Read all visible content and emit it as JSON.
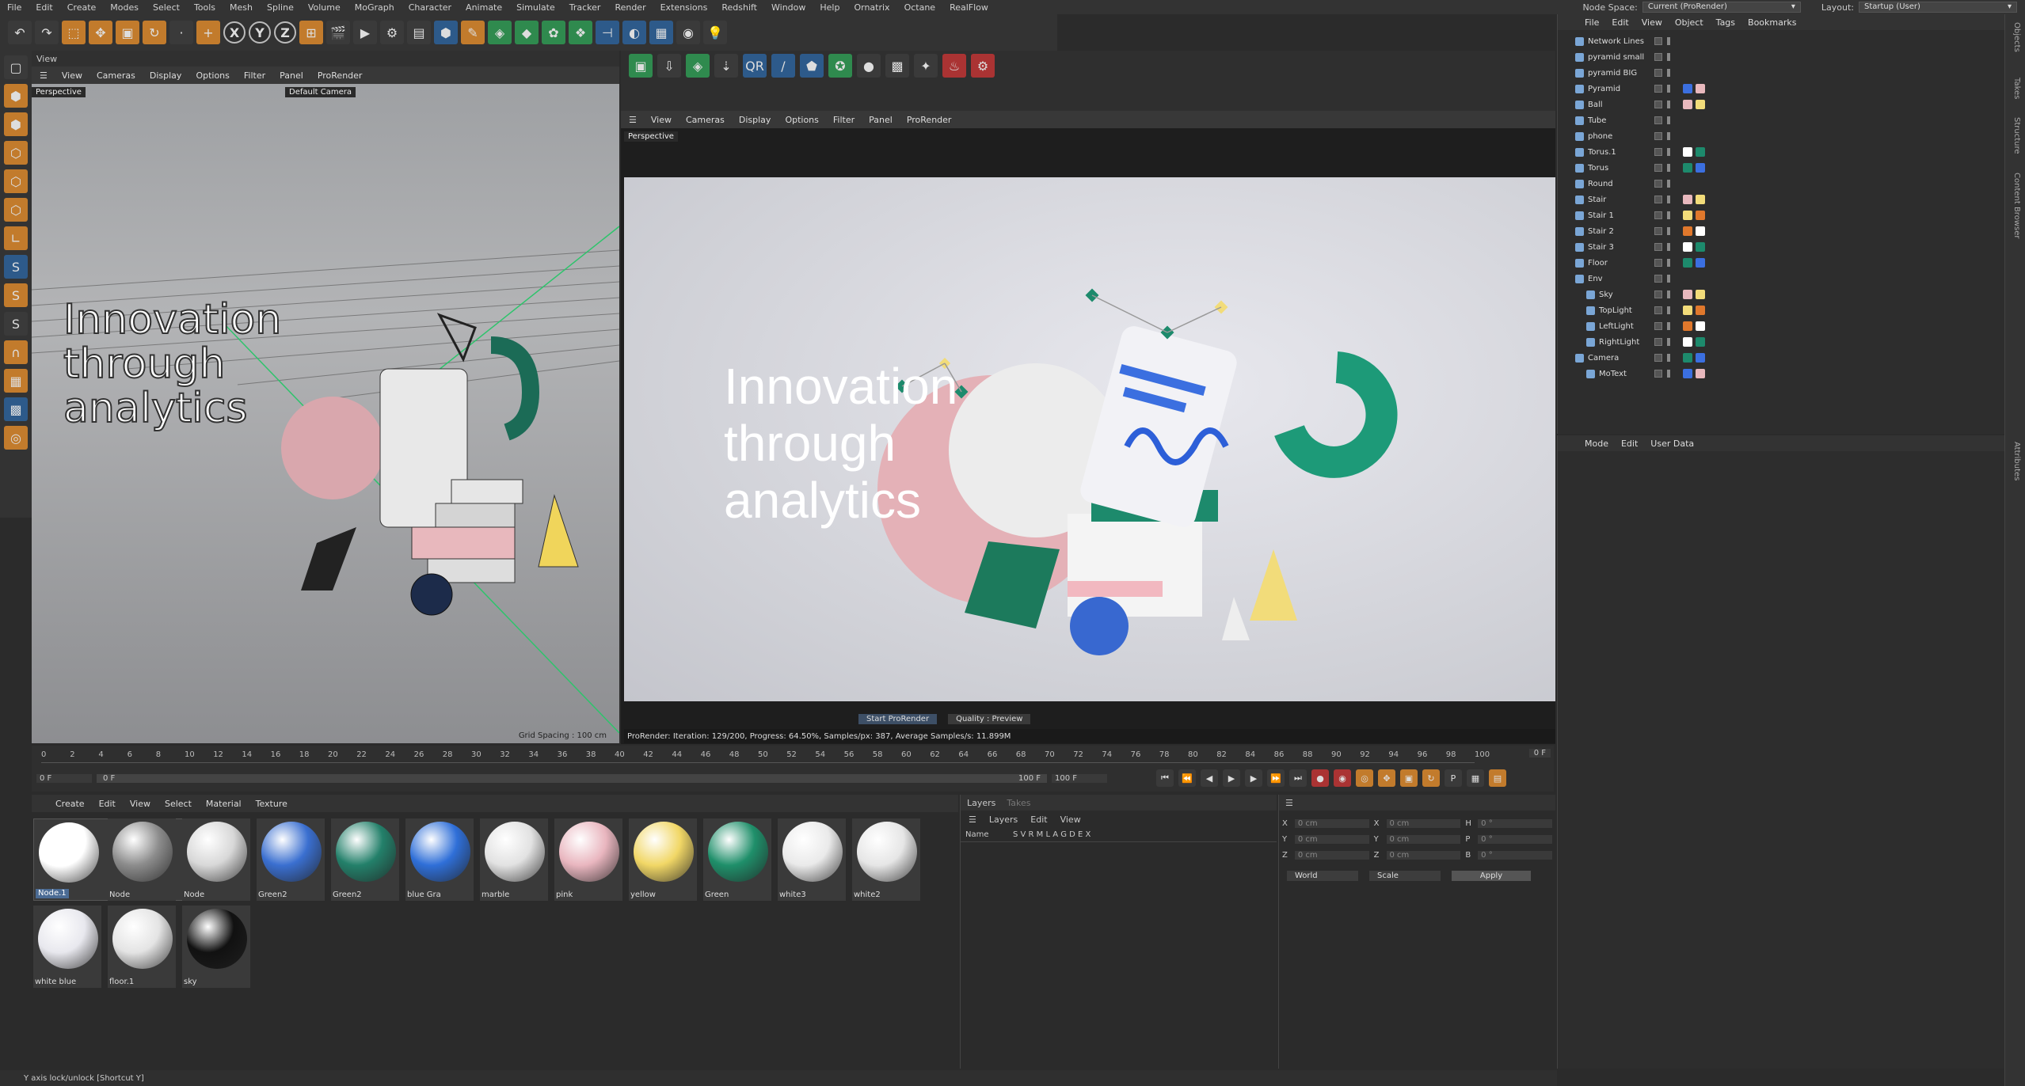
{
  "menubar": {
    "items": [
      "File",
      "Edit",
      "Create",
      "Modes",
      "Select",
      "Tools",
      "Mesh",
      "Spline",
      "Volume",
      "MoGraph",
      "Character",
      "Animate",
      "Simulate",
      "Tracker",
      "Render",
      "Extensions",
      "Redshift",
      "Window",
      "Help",
      "Ornatrix",
      "Octane",
      "RealFlow"
    ],
    "node_space_label": "Node Space:",
    "node_space_value": "Current (ProRender)",
    "layout_label": "Layout:",
    "layout_value": "Startup (User)"
  },
  "viewport_left": {
    "tab": "View",
    "menu": [
      "View",
      "Cameras",
      "Display",
      "Options",
      "Filter",
      "Panel",
      "ProRender"
    ],
    "label": "Perspective",
    "camera": "Default Camera",
    "grid_spacing": "Grid Spacing : 100 cm",
    "text3d": "Innovation\nthrough\nanalytics"
  },
  "viewport_right": {
    "menu": [
      "View",
      "Cameras",
      "Display",
      "Options",
      "Filter",
      "Panel",
      "ProRender"
    ],
    "label": "Perspective",
    "render_text": "Innovation\nthrough\nanalytics",
    "status": "ProRender: Iteration: 129/200, Progress: 64.50%, Samples/px: 387, Average Samples/s: 11.899M",
    "start_button": "Start ProRender",
    "quality_button": "Quality : Preview"
  },
  "timeline": {
    "ticks": [
      "0",
      "2",
      "4",
      "6",
      "8",
      "10",
      "12",
      "14",
      "16",
      "18",
      "20",
      "22",
      "24",
      "26",
      "28",
      "30",
      "32",
      "34",
      "36",
      "38",
      "40",
      "42",
      "44",
      "46",
      "48",
      "50",
      "52",
      "54",
      "56",
      "58",
      "60",
      "62",
      "64",
      "66",
      "68",
      "70",
      "72",
      "74",
      "76",
      "78",
      "80",
      "82",
      "84",
      "86",
      "88",
      "90",
      "92",
      "94",
      "96",
      "98",
      "100"
    ],
    "current_frame": "0 F",
    "start_field": "0 F",
    "start_field2": "0 F",
    "end_field": "100 F",
    "end_field2": "100 F"
  },
  "materials": {
    "menu": [
      "Create",
      "Edit",
      "View",
      "Select",
      "Material",
      "Texture"
    ],
    "items": [
      {
        "name": "Node.1",
        "color": "#ffffff"
      },
      {
        "name": "Node",
        "color": "#8c8c8c"
      },
      {
        "name": "Node",
        "color": "#d8d8d8"
      },
      {
        "name": "Green2",
        "color": "#3a6fd0"
      },
      {
        "name": "Green2",
        "color": "#23806a"
      },
      {
        "name": "blue Gra",
        "color": "#2f6fd8"
      },
      {
        "name": "marble",
        "color": "#e2e2e2"
      },
      {
        "name": "pink",
        "color": "#e9b6bf"
      },
      {
        "name": "yellow",
        "color": "#f1d766"
      },
      {
        "name": "Green",
        "color": "#1f8f6a"
      },
      {
        "name": "white3",
        "color": "#eaeaea"
      },
      {
        "name": "white2",
        "color": "#e6e6e6"
      },
      {
        "name": "white blue",
        "color": "#e8e8ee"
      },
      {
        "name": "floor.1",
        "color": "#e4e4e4"
      },
      {
        "name": "sky",
        "color": "#111111"
      }
    ]
  },
  "layers": {
    "tabs": [
      "Layers",
      "Takes"
    ],
    "menu": [
      "Layers",
      "Edit",
      "View"
    ],
    "col_name": "Name",
    "col_flags": "S V R M L A G D E X"
  },
  "coords": {
    "rows": [
      {
        "a": "X",
        "av": "0 cm",
        "b": "X",
        "bv": "0 cm",
        "c": "H",
        "cv": "0 °"
      },
      {
        "a": "Y",
        "av": "0 cm",
        "b": "Y",
        "bv": "0 cm",
        "c": "P",
        "cv": "0 °"
      },
      {
        "a": "Z",
        "av": "0 cm",
        "b": "Z",
        "bv": "0 cm",
        "c": "B",
        "cv": "0 °"
      }
    ],
    "space": "World",
    "mode": "Scale",
    "apply": "Apply"
  },
  "objects": {
    "menu": [
      "File",
      "Edit",
      "View",
      "Object",
      "Tags",
      "Bookmarks"
    ],
    "items": [
      {
        "name": "Network Lines",
        "indent": 0
      },
      {
        "name": "pyramid small",
        "indent": 0
      },
      {
        "name": "pyramid BIG",
        "indent": 0
      },
      {
        "name": "Pyramid",
        "indent": 0
      },
      {
        "name": "Ball",
        "indent": 0
      },
      {
        "name": "Tube",
        "indent": 0
      },
      {
        "name": "phone",
        "indent": 0
      },
      {
        "name": "Torus.1",
        "indent": 0
      },
      {
        "name": "Torus",
        "indent": 0
      },
      {
        "name": "Round",
        "indent": 0
      },
      {
        "name": "Stair",
        "indent": 0
      },
      {
        "name": "Stair 1",
        "indent": 0
      },
      {
        "name": "Stair 2",
        "indent": 0
      },
      {
        "name": "Stair 3",
        "indent": 0
      },
      {
        "name": "Floor",
        "indent": 0
      },
      {
        "name": "Env",
        "indent": 0
      },
      {
        "name": "Sky",
        "indent": 1
      },
      {
        "name": "TopLight",
        "indent": 1
      },
      {
        "name": "LeftLight",
        "indent": 1
      },
      {
        "name": "RightLight",
        "indent": 1
      },
      {
        "name": "Camera",
        "indent": 0
      },
      {
        "name": "MoText",
        "indent": 1
      }
    ]
  },
  "attributes": {
    "menu": [
      "Mode",
      "Edit",
      "User Data"
    ]
  },
  "side_tabs": [
    "Objects",
    "Takes",
    "Structure",
    "Content Browser",
    "Attributes"
  ],
  "status_bar": "Y axis lock/unlock [Shortcut Y]"
}
